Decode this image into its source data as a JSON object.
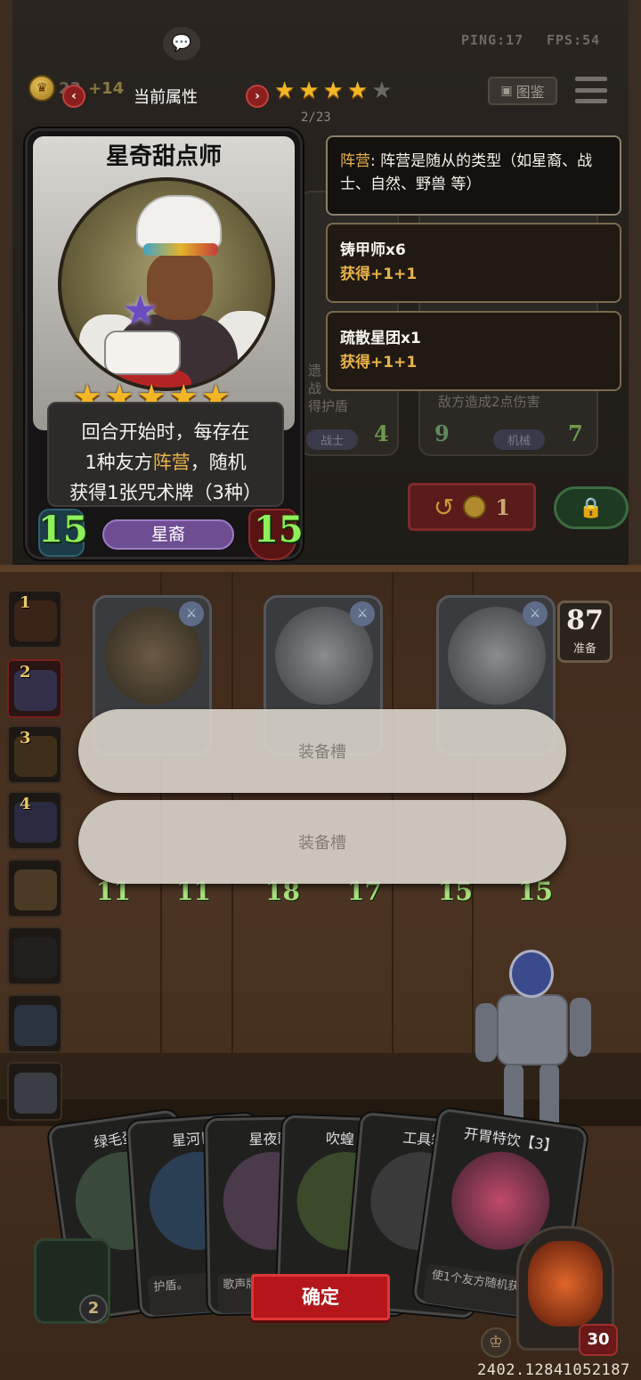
{
  "top_bar": {
    "ping_label": "PING:17",
    "fps_label": "FPS:54",
    "gold_value": "23",
    "gold_bonus": "+14",
    "attr_title": "当前属性",
    "prev_icon": "chevron-left-icon",
    "next_icon": "chevron-right-icon",
    "tavern_stars_total": 5,
    "tavern_stars_filled": 4,
    "codex_label": "图鉴",
    "page_indicator": "2/23"
  },
  "selected_card": {
    "name": "星奇甜点师",
    "stars": 5,
    "desc_lines": [
      {
        "pre": "回合开始时，每存在",
        "hl": "",
        "post": ""
      },
      {
        "pre": "1种友方",
        "hl": "阵营",
        "post": "，随机"
      },
      {
        "pre": "获得1张咒术牌（3种）",
        "hl": "",
        "post": ""
      }
    ],
    "attack": "15",
    "health": "15",
    "tribe": "星裔"
  },
  "tooltips": {
    "keyword": {
      "hl": "阵营",
      "text": ": 阵营是随从的类型（如星裔、战士、自然、野兽 等）"
    },
    "bonuses": [
      {
        "name": "铸甲师x6",
        "value": "获得+1+1"
      },
      {
        "name": "疏散星团x1",
        "value": "获得+1+1"
      }
    ]
  },
  "shop_background": {
    "card2_desc": "敌方造成2点伤害",
    "card2_tag": "机械",
    "card2_atk": "9",
    "card2_hp": "7",
    "card1_tag": "战士",
    "card1_hp": "4",
    "card1_text": [
      "遗",
      "战",
      "得护盾"
    ],
    "refresh_cost": "1"
  },
  "board": {
    "side_slots": [
      "1",
      "2",
      "3",
      "4",
      "",
      "",
      "",
      ""
    ],
    "timer_value": "87",
    "timer_label": "准备",
    "minions": [
      {
        "atk": "11",
        "hp": "11"
      },
      {
        "atk": "18",
        "hp": "17"
      },
      {
        "atk": "15",
        "hp": "15"
      }
    ],
    "equip_slot_1": "装备槽",
    "equip_slot_2": "装备槽"
  },
  "hand": {
    "cards": [
      {
        "name": "绿毛蛋",
        "desc": ""
      },
      {
        "name": "星河巨",
        "desc": "护盾。"
      },
      {
        "name": "星夜歌",
        "desc": "歌声牌。"
      },
      {
        "name": "吹蝗【",
        "desc": ""
      },
      {
        "name": "工具箱",
        "desc": ""
      },
      {
        "name": "开胃特饮【3】",
        "desc": "使1个友方随机获得"
      }
    ],
    "confirm_label": "确定",
    "gold_slot_value": "2",
    "hero_health": "30",
    "build_id": "2402.12841052187"
  },
  "colors": {
    "accent_gold": "#e9b34a",
    "stat_green": "#8ef05a",
    "confirm_red": "#b4161c",
    "tribe_purple": "#6e4d93"
  }
}
